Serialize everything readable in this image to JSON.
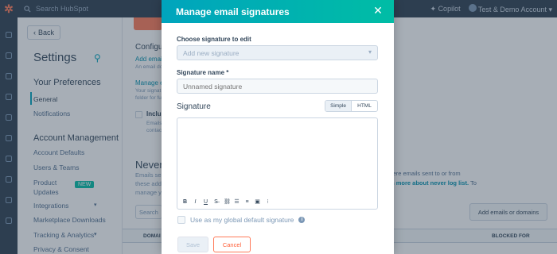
{
  "topnav": {
    "logo": "✲",
    "search_placeholder": "Search HubSpot",
    "copilot": "Copilot",
    "account": "Test & Demo Account"
  },
  "sidebar": {
    "back_label": "Back",
    "title": "Settings",
    "section_preferences": "Your Preferences",
    "items_preferences": [
      "General",
      "Notifications"
    ],
    "section_account": "Account Management",
    "items_account": [
      "Account Defaults",
      "Users & Teams",
      "Product Updates",
      "Integrations",
      "Marketplace Downloads",
      "Tracking & Analytics",
      "Privacy & Consent"
    ],
    "new_badge": "NEW"
  },
  "main": {
    "heading": "Configu",
    "link1": "Add email",
    "small1": "An email do",
    "link2": "Manage e",
    "small2a": "Your signat",
    "small2b": "folder for fut",
    "check_label": "Inclu",
    "check_small1": "Emails",
    "check_small2": "contact",
    "never_heading": "Never l",
    "never_small1": "Emails se",
    "never_small2": "these addr",
    "never_small3": "manage y",
    "right_text": "where emails sent to or from",
    "right_link": "arn more about never log list.",
    "right_link_suffix": "To",
    "add_btn": "Add emails or domains",
    "search": "Search",
    "col1": "DOMAI",
    "col2": "BLOCKED FOR"
  },
  "modal": {
    "title": "Manage email signatures",
    "choose_label": "Choose signature to edit",
    "choose_placeholder": "Add new signature",
    "name_label": "Signature name *",
    "name_placeholder": "Unnamed signature",
    "signature_label": "Signature",
    "toggle_simple": "Simple",
    "toggle_html": "HTML",
    "global_default_label": "Use as my global default signature",
    "save_label": "Save",
    "cancel_label": "Cancel"
  }
}
